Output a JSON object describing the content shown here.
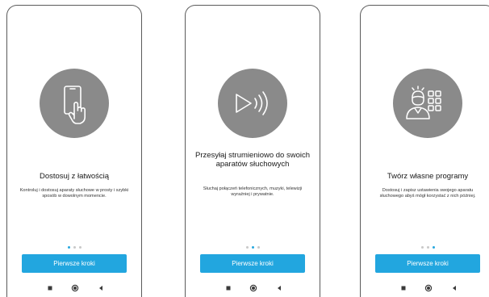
{
  "screens": [
    {
      "icon": "phone-touch-icon",
      "title": "Dostosuj z łatwością",
      "description": "Kontroluj i dostosuj aparaty słuchowe w prosty i szybki sposób w dowolnym momencie.",
      "active_dot": 0,
      "cta_label": "Pierwsze kroki"
    },
    {
      "icon": "audio-stream-icon",
      "title": "Przesyłaj strumieniowo do swoich aparatów słuchowych",
      "description": "Słuchaj połączeń telefonicznych, muzyki, telewizji wyraźniej i prywatnie.",
      "active_dot": 1,
      "cta_label": "Pierwsze kroki"
    },
    {
      "icon": "person-programs-icon",
      "title": "Twórz własne programy",
      "description": "Dostosuj i zapisz ustawienia swojego aparatu słuchowego abyś mógł korzystać z nich później.",
      "active_dot": 2,
      "cta_label": "Pierwsze kroki"
    }
  ],
  "colors": {
    "accent": "#22a6df",
    "icon_circle": "#8a8a8a",
    "dot_inactive": "#c9c9c9"
  },
  "navbar_icons": [
    "recents-icon",
    "home-icon",
    "back-icon"
  ]
}
